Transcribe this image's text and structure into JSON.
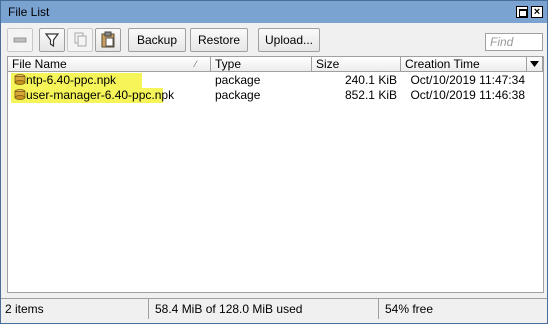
{
  "window": {
    "title": "File List"
  },
  "toolbar": {
    "backup_label": "Backup",
    "restore_label": "Restore",
    "upload_label": "Upload...",
    "find_placeholder": "Find"
  },
  "columns": [
    {
      "label": "File Name"
    },
    {
      "label": "Type"
    },
    {
      "label": "Size"
    },
    {
      "label": "Creation Time"
    }
  ],
  "files": [
    {
      "name": "ntp-6.40-ppc.npk",
      "type": "package",
      "size": "240.1 KiB",
      "created": "Oct/10/2019 11:47:34"
    },
    {
      "name": "user-manager-6.40-ppc.npk",
      "type": "package",
      "size": "852.1 KiB",
      "created": "Oct/10/2019 11:46:38"
    }
  ],
  "status": {
    "items": "2 items",
    "usage": "58.4 MiB of 128.0 MiB used",
    "free": "54% free"
  },
  "colors": {
    "titlebar": "#7aa3d2",
    "highlight": "#f5f55a",
    "file_icon": "#c89620"
  },
  "icons": {
    "minus": "minus-icon",
    "filter": "filter-icon",
    "copy": "copy-icon",
    "paste": "paste-icon",
    "file": "package-file-icon",
    "sort": "sort-indicator-icon",
    "column_menu": "column-dropdown-icon"
  }
}
